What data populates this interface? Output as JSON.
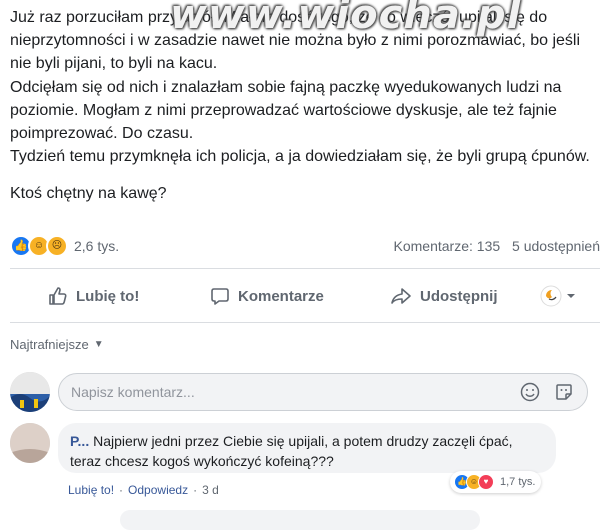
{
  "watermark": "www.wiocha.pl",
  "post": {
    "paragraphs": [
      "Już raz porzuciłam przyjaciół. Miałam dość tego, że co wieczór upijali się do nieprzytomności i w zasadzie nawet nie można było z nimi porozmawiać, bo jeśli nie byli pijani, to byli na kacu.",
      "Odcięłam się od nich i znalazłam sobie fajną paczkę wyedukowanych ludzi na poziomie. Mogłam z nimi przeprowadzać wartościowe dyskusje, ale też fajnie poimprezować. Do czasu.",
      "Tydzień temu przymknęła ich policja, a ja dowiedziałam się, że byli grupą ćpunów."
    ],
    "question": "Ktoś chętny na kawę?"
  },
  "reactions": {
    "icons": [
      "like-icon",
      "haha-icon",
      "sad-icon"
    ],
    "count": "2,6 tys.",
    "comments": "Komentarze: 135",
    "shares": "5 udostępnień"
  },
  "actions": {
    "like": "Lubię to!",
    "comment": "Komentarze",
    "share": "Udostępnij"
  },
  "sort": {
    "label": "Najtrafniejsze"
  },
  "composer": {
    "placeholder": "Napisz komentarz..."
  },
  "comment": {
    "author": "P...",
    "text": "Najpierw jedni przez Ciebie się upijali, a potem drudzy zaczęli ćpać, teraz chcesz kogoś wykończyć kofeiną???",
    "like_link": "Lubię to!",
    "reply_link": "Odpowiedz",
    "time": "3 d",
    "reaction_count": "1,7 tys.",
    "reaction_icons": [
      "like-icon",
      "haha-icon",
      "love-icon"
    ]
  },
  "colors": {
    "link": "#385898",
    "secondary_text": "#606770",
    "like_blue": "#1877f2"
  }
}
